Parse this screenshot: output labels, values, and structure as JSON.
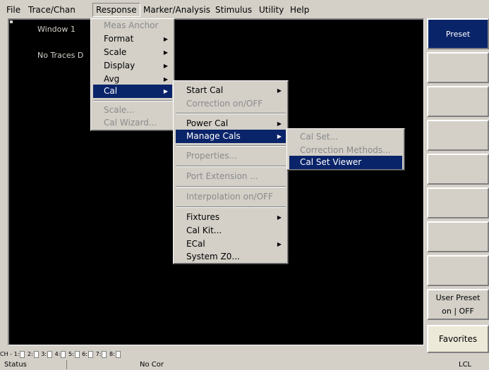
{
  "menubar": {
    "items": [
      "File",
      "Trace/Chan",
      "Response",
      "Marker/Analysis",
      "Stimulus",
      "Utility",
      "Help"
    ]
  },
  "window": {
    "title": "Window 1",
    "message": "No Traces D"
  },
  "response_menu": {
    "items": [
      "Meas Anchor",
      "Format",
      "Scale",
      "Display",
      "Avg",
      "Cal",
      "Scale...",
      "Cal Wizard..."
    ]
  },
  "cal_menu": {
    "items": [
      "Start Cal",
      "Correction on/OFF",
      "Power Cal",
      "Manage Cals",
      "Properties...",
      "Port Extension ...",
      "Interpolation on/OFF",
      "Fixtures",
      "Cal Kit...",
      "ECal",
      "System Z0..."
    ]
  },
  "manage_menu": {
    "items": [
      "Cal Set...",
      "Correction Methods...",
      "Cal Set Viewer"
    ]
  },
  "softkeys": {
    "preset": "Preset",
    "user_preset_line1": "User Preset",
    "user_preset_line2": "on | OFF",
    "favorites": "Favorites"
  },
  "channels": {
    "prefix": "CH -",
    "labels": [
      "1:",
      "2:",
      "3:",
      "4:",
      "5:",
      "6:",
      "7:",
      "8:"
    ]
  },
  "status": {
    "label": "Status",
    "correction": "No Cor",
    "mode": "LCL"
  },
  "colors": {
    "highlight": "#0a246a",
    "chrome": "#d4d0c8",
    "screen": "#000000"
  }
}
